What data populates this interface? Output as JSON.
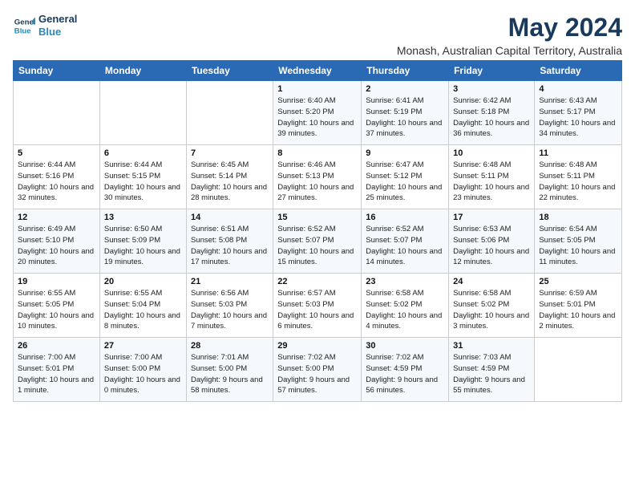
{
  "logo": {
    "line1": "General",
    "line2": "Blue"
  },
  "title": "May 2024",
  "location": "Monash, Australian Capital Territory, Australia",
  "headers": [
    "Sunday",
    "Monday",
    "Tuesday",
    "Wednesday",
    "Thursday",
    "Friday",
    "Saturday"
  ],
  "weeks": [
    [
      {
        "day": "",
        "sunrise": "",
        "sunset": "",
        "daylight": ""
      },
      {
        "day": "",
        "sunrise": "",
        "sunset": "",
        "daylight": ""
      },
      {
        "day": "",
        "sunrise": "",
        "sunset": "",
        "daylight": ""
      },
      {
        "day": "1",
        "sunrise": "Sunrise: 6:40 AM",
        "sunset": "Sunset: 5:20 PM",
        "daylight": "Daylight: 10 hours and 39 minutes."
      },
      {
        "day": "2",
        "sunrise": "Sunrise: 6:41 AM",
        "sunset": "Sunset: 5:19 PM",
        "daylight": "Daylight: 10 hours and 37 minutes."
      },
      {
        "day": "3",
        "sunrise": "Sunrise: 6:42 AM",
        "sunset": "Sunset: 5:18 PM",
        "daylight": "Daylight: 10 hours and 36 minutes."
      },
      {
        "day": "4",
        "sunrise": "Sunrise: 6:43 AM",
        "sunset": "Sunset: 5:17 PM",
        "daylight": "Daylight: 10 hours and 34 minutes."
      }
    ],
    [
      {
        "day": "5",
        "sunrise": "Sunrise: 6:44 AM",
        "sunset": "Sunset: 5:16 PM",
        "daylight": "Daylight: 10 hours and 32 minutes."
      },
      {
        "day": "6",
        "sunrise": "Sunrise: 6:44 AM",
        "sunset": "Sunset: 5:15 PM",
        "daylight": "Daylight: 10 hours and 30 minutes."
      },
      {
        "day": "7",
        "sunrise": "Sunrise: 6:45 AM",
        "sunset": "Sunset: 5:14 PM",
        "daylight": "Daylight: 10 hours and 28 minutes."
      },
      {
        "day": "8",
        "sunrise": "Sunrise: 6:46 AM",
        "sunset": "Sunset: 5:13 PM",
        "daylight": "Daylight: 10 hours and 27 minutes."
      },
      {
        "day": "9",
        "sunrise": "Sunrise: 6:47 AM",
        "sunset": "Sunset: 5:12 PM",
        "daylight": "Daylight: 10 hours and 25 minutes."
      },
      {
        "day": "10",
        "sunrise": "Sunrise: 6:48 AM",
        "sunset": "Sunset: 5:11 PM",
        "daylight": "Daylight: 10 hours and 23 minutes."
      },
      {
        "day": "11",
        "sunrise": "Sunrise: 6:48 AM",
        "sunset": "Sunset: 5:11 PM",
        "daylight": "Daylight: 10 hours and 22 minutes."
      }
    ],
    [
      {
        "day": "12",
        "sunrise": "Sunrise: 6:49 AM",
        "sunset": "Sunset: 5:10 PM",
        "daylight": "Daylight: 10 hours and 20 minutes."
      },
      {
        "day": "13",
        "sunrise": "Sunrise: 6:50 AM",
        "sunset": "Sunset: 5:09 PM",
        "daylight": "Daylight: 10 hours and 19 minutes."
      },
      {
        "day": "14",
        "sunrise": "Sunrise: 6:51 AM",
        "sunset": "Sunset: 5:08 PM",
        "daylight": "Daylight: 10 hours and 17 minutes."
      },
      {
        "day": "15",
        "sunrise": "Sunrise: 6:52 AM",
        "sunset": "Sunset: 5:07 PM",
        "daylight": "Daylight: 10 hours and 15 minutes."
      },
      {
        "day": "16",
        "sunrise": "Sunrise: 6:52 AM",
        "sunset": "Sunset: 5:07 PM",
        "daylight": "Daylight: 10 hours and 14 minutes."
      },
      {
        "day": "17",
        "sunrise": "Sunrise: 6:53 AM",
        "sunset": "Sunset: 5:06 PM",
        "daylight": "Daylight: 10 hours and 12 minutes."
      },
      {
        "day": "18",
        "sunrise": "Sunrise: 6:54 AM",
        "sunset": "Sunset: 5:05 PM",
        "daylight": "Daylight: 10 hours and 11 minutes."
      }
    ],
    [
      {
        "day": "19",
        "sunrise": "Sunrise: 6:55 AM",
        "sunset": "Sunset: 5:05 PM",
        "daylight": "Daylight: 10 hours and 10 minutes."
      },
      {
        "day": "20",
        "sunrise": "Sunrise: 6:55 AM",
        "sunset": "Sunset: 5:04 PM",
        "daylight": "Daylight: 10 hours and 8 minutes."
      },
      {
        "day": "21",
        "sunrise": "Sunrise: 6:56 AM",
        "sunset": "Sunset: 5:03 PM",
        "daylight": "Daylight: 10 hours and 7 minutes."
      },
      {
        "day": "22",
        "sunrise": "Sunrise: 6:57 AM",
        "sunset": "Sunset: 5:03 PM",
        "daylight": "Daylight: 10 hours and 6 minutes."
      },
      {
        "day": "23",
        "sunrise": "Sunrise: 6:58 AM",
        "sunset": "Sunset: 5:02 PM",
        "daylight": "Daylight: 10 hours and 4 minutes."
      },
      {
        "day": "24",
        "sunrise": "Sunrise: 6:58 AM",
        "sunset": "Sunset: 5:02 PM",
        "daylight": "Daylight: 10 hours and 3 minutes."
      },
      {
        "day": "25",
        "sunrise": "Sunrise: 6:59 AM",
        "sunset": "Sunset: 5:01 PM",
        "daylight": "Daylight: 10 hours and 2 minutes."
      }
    ],
    [
      {
        "day": "26",
        "sunrise": "Sunrise: 7:00 AM",
        "sunset": "Sunset: 5:01 PM",
        "daylight": "Daylight: 10 hours and 1 minute."
      },
      {
        "day": "27",
        "sunrise": "Sunrise: 7:00 AM",
        "sunset": "Sunset: 5:00 PM",
        "daylight": "Daylight: 10 hours and 0 minutes."
      },
      {
        "day": "28",
        "sunrise": "Sunrise: 7:01 AM",
        "sunset": "Sunset: 5:00 PM",
        "daylight": "Daylight: 9 hours and 58 minutes."
      },
      {
        "day": "29",
        "sunrise": "Sunrise: 7:02 AM",
        "sunset": "Sunset: 5:00 PM",
        "daylight": "Daylight: 9 hours and 57 minutes."
      },
      {
        "day": "30",
        "sunrise": "Sunrise: 7:02 AM",
        "sunset": "Sunset: 4:59 PM",
        "daylight": "Daylight: 9 hours and 56 minutes."
      },
      {
        "day": "31",
        "sunrise": "Sunrise: 7:03 AM",
        "sunset": "Sunset: 4:59 PM",
        "daylight": "Daylight: 9 hours and 55 minutes."
      },
      {
        "day": "",
        "sunrise": "",
        "sunset": "",
        "daylight": ""
      }
    ]
  ]
}
